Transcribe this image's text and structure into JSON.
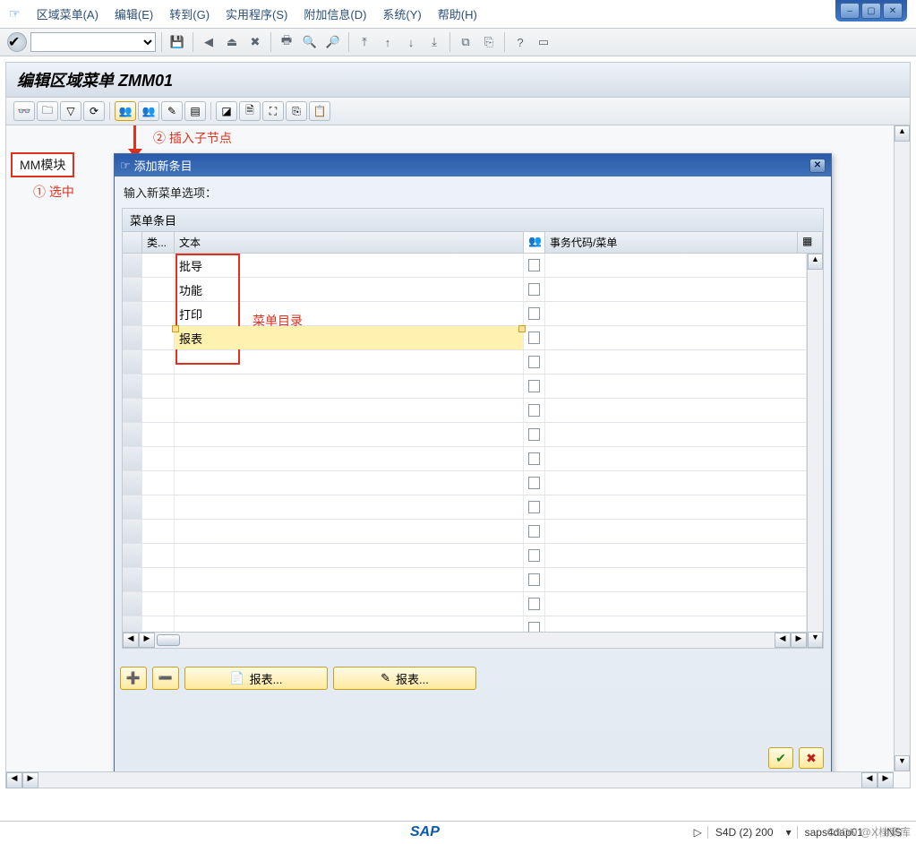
{
  "window_buttons": {
    "min": "–",
    "max": "▢",
    "close": "✕"
  },
  "menubar": {
    "items": [
      {
        "label": "区域菜单(A)"
      },
      {
        "label": "编辑(E)"
      },
      {
        "label": "转到(G)"
      },
      {
        "label": "实用程序(S)"
      },
      {
        "label": "附加信息(D)"
      },
      {
        "label": "系统(Y)"
      },
      {
        "label": "帮助(H)"
      }
    ]
  },
  "page_title": "编辑区域菜单 ZMM01",
  "tree_root": "MM模块",
  "annotation1": "① 选中",
  "annotation2": "② 插入子节点",
  "annotation3": "菜单目录",
  "dialog": {
    "title": "添加新条目",
    "hint": "输入新菜单选项：",
    "group": "菜单条目",
    "columns": {
      "type": "类...",
      "text": "文本",
      "code": "事务代码/菜单"
    },
    "rows": [
      {
        "text": "批导",
        "active": false
      },
      {
        "text": "功能",
        "active": false
      },
      {
        "text": "打印",
        "active": false
      },
      {
        "text": "报表",
        "active": true
      }
    ],
    "blank_rows": 12,
    "btn_report1": "报表...",
    "btn_report2": "报表..."
  },
  "status": {
    "system": "S4D (2) 200",
    "host": "saps4dap01",
    "mode": "INS",
    "watermark": "CSDN @X档案库"
  }
}
